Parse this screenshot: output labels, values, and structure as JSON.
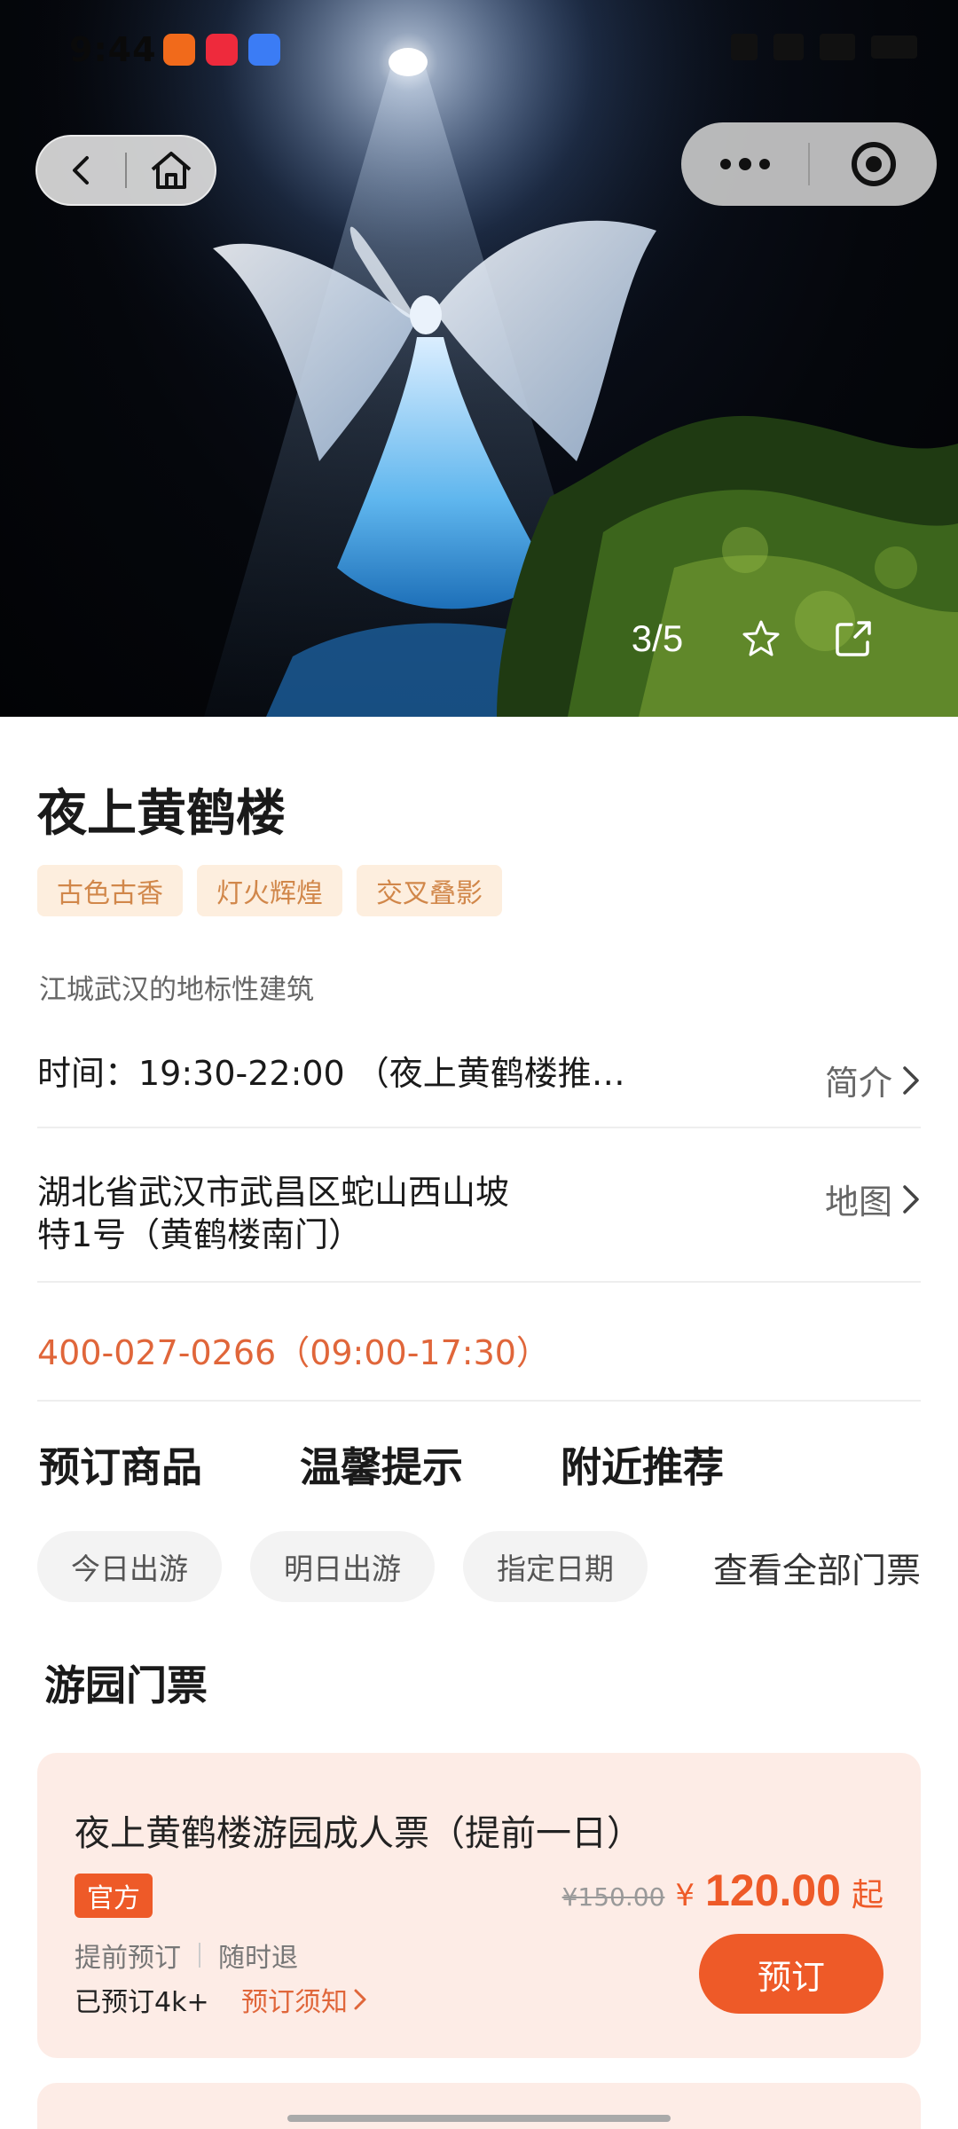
{
  "status_bar": {
    "time": "9:44",
    "apps": [
      "app-icon-orange",
      "xiaohongshu-icon",
      "blue-app-icon"
    ]
  },
  "hero": {
    "photo_counter": "3/5",
    "icons": {
      "back": "chevron-left-icon",
      "home": "home-icon",
      "more": "more-dots-icon",
      "close": "target-circle-icon",
      "favorite": "star-icon",
      "share": "share-icon"
    }
  },
  "attraction": {
    "title": "夜上黄鹤楼",
    "tags": [
      "古色古香",
      "灯火辉煌",
      "交叉叠影"
    ],
    "subtitle": "江城武汉的地标性建筑",
    "time_text": "时间：19:30-22:00 （夜上黄鹤楼推…",
    "intro_label": "简介",
    "address_line1": "湖北省武汉市武昌区蛇山西山坡",
    "address_line2": "特1号（黄鹤楼南门）",
    "map_label": "地图",
    "phone": "400-027-0266（09:00-17:30）"
  },
  "section_tabs": [
    "预订商品",
    "温馨提示",
    "附近推荐"
  ],
  "date_chips": [
    "今日出游",
    "明日出游",
    "指定日期"
  ],
  "view_all": "查看全部门票",
  "sub_heading": "游园门票",
  "ticket": {
    "name": "夜上黄鹤楼游园成人票（提前一日）",
    "badge": "官方",
    "feature1": "提前预订",
    "feature2": "随时退",
    "booked": "已预订4k+",
    "notice": "预订须知",
    "old_price": "¥150.00",
    "currency": "¥",
    "price": "120.00",
    "price_suffix": "起",
    "book_label": "预订"
  },
  "colors": {
    "accent": "#ee5a28",
    "tag_bg": "#fdeede",
    "tag_text": "#d1874a",
    "card_bg": "#fdece6"
  }
}
